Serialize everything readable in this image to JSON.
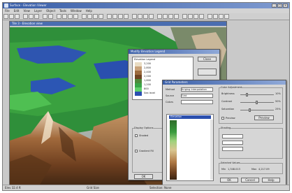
{
  "window": {
    "title": "Surface - Elevation Viewer"
  },
  "menu": [
    "File",
    "Edit",
    "View",
    "Layer",
    "Object",
    "Tools",
    "Window",
    "Help"
  ],
  "viewport": {
    "title": "Tile 3 - Elevation view"
  },
  "legend_dialog": {
    "title": "Modify Elevation Legend",
    "legend_header": "Elevation Legend",
    "close_button": "Close",
    "entries": [
      "3,200",
      "2,800",
      "2,400",
      "2,000",
      "1,600",
      "1,200",
      "800",
      "Sea level"
    ],
    "group_label": "Display Options",
    "option_label": "Shaded",
    "option_label2": "Gradient Fill",
    "ok_button": "OK"
  },
  "grid_dialog": {
    "title": "Grid Parameters",
    "method_label": "Method",
    "method_value": "Kriging Interpolation",
    "source_label": "Source",
    "source_value": "Grid",
    "colors_label": "Colors",
    "selected_color": "Elevation",
    "slider_group": "Color Adjustment",
    "slider_labels": [
      "Brightness",
      "Contrast",
      "Saturation"
    ],
    "slider_values": [
      "10%",
      "50%",
      "25%"
    ],
    "preview_label": "Preview",
    "preview_button": "Preview",
    "shading_label": "Shading",
    "selection_label": "Selected Values",
    "min_label": "Min",
    "min_value": "1,348.013",
    "max_label": "Max",
    "max_value": "4,217.09",
    "ok_button": "OK",
    "cancel_button": "Cancel",
    "help_button": "Help"
  },
  "status": [
    "Elev 32.4 ft",
    "Grid Size",
    "Selection: None"
  ],
  "colors": {
    "titlebar": "#3a5fa8",
    "dialog_bg": "#d6d6d6"
  }
}
